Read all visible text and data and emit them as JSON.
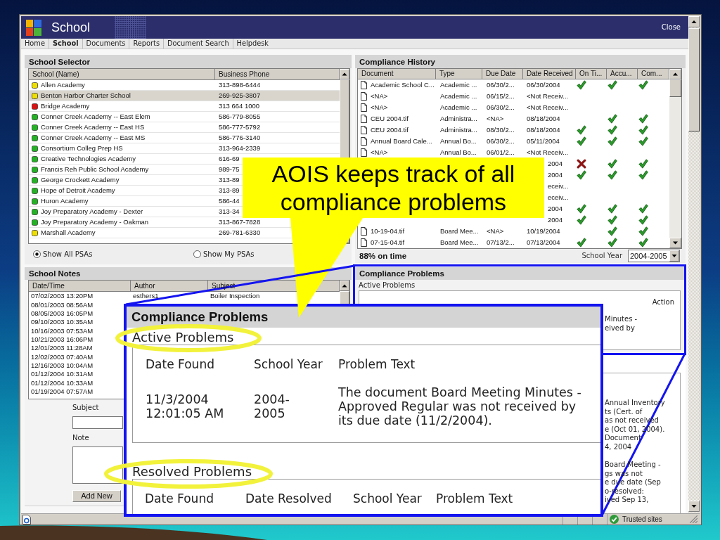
{
  "window": {
    "title": "School",
    "close_label": "Close"
  },
  "menu": [
    {
      "label": "Home",
      "selected": false
    },
    {
      "label": "School",
      "selected": true
    },
    {
      "label": "Documents",
      "selected": false
    },
    {
      "label": "Reports",
      "selected": false
    },
    {
      "label": "Document Search",
      "selected": false
    },
    {
      "label": "Helpdesk",
      "selected": false
    }
  ],
  "school_selector": {
    "title": "School Selector",
    "columns": [
      "School (Name)",
      "Business Phone"
    ],
    "rows": [
      {
        "name": "Allen Academy",
        "phone": "313-898-6444",
        "color": "#efdf00",
        "selected": false
      },
      {
        "name": "Benton Harbor Charter School",
        "phone": "269-925-3807",
        "color": "#efdf00",
        "selected": true
      },
      {
        "name": "Bridge Academy",
        "phone": "313 664 1000",
        "color": "#dd1111",
        "selected": false
      },
      {
        "name": "Conner Creek Academy -- East Elem",
        "phone": "586-779-8055",
        "color": "#22b322",
        "selected": false
      },
      {
        "name": "Conner Creek Academy -- East HS",
        "phone": "586-777-5792",
        "color": "#22b322",
        "selected": false
      },
      {
        "name": "Conner Creek Academy -- East MS",
        "phone": "586-776-3140",
        "color": "#22b322",
        "selected": false
      },
      {
        "name": "Consortium Colleg Prep HS",
        "phone": "313-964-2339",
        "color": "#22b322",
        "selected": false
      },
      {
        "name": "Creative Technologies Academy",
        "phone": "616-69",
        "color": "#22b322",
        "selected": false
      },
      {
        "name": "Francis Reh Public School Academy",
        "phone": "989-75",
        "color": "#22b322",
        "selected": false
      },
      {
        "name": "George Crockett Academy",
        "phone": "313-89",
        "color": "#22b322",
        "selected": false
      },
      {
        "name": "Hope of Detroit Academy",
        "phone": "313-89",
        "color": "#22b322",
        "selected": false
      },
      {
        "name": "Huron Academy",
        "phone": "586-44",
        "color": "#22b322",
        "selected": false
      },
      {
        "name": "Joy Preparatory Academy - Dexter",
        "phone": "313-34",
        "color": "#22b322",
        "selected": false
      },
      {
        "name": "Joy Preparatory Academy - Oakman",
        "phone": "313-867-7828",
        "color": "#22b322",
        "selected": false
      },
      {
        "name": "Marshall Academy",
        "phone": "269-781-6330",
        "color": "#efdf00",
        "selected": false
      }
    ],
    "filters": [
      {
        "label": "Show All PSAs",
        "selected": true
      },
      {
        "label": "Show My PSAs",
        "selected": false
      }
    ]
  },
  "school_notes": {
    "title": "School Notes",
    "columns": [
      "Date/Time",
      "Author",
      "Subject"
    ],
    "rows": [
      {
        "date": "07/02/2003 13:20PM",
        "author": "esthers1",
        "subject": "Boiler Inspection"
      },
      {
        "date": "08/01/2003 08:56AM"
      },
      {
        "date": "08/05/2003 16:05PM"
      },
      {
        "date": "09/10/2003 10:35AM"
      },
      {
        "date": "10/16/2003 07:53AM"
      },
      {
        "date": "10/21/2003 16:06PM"
      },
      {
        "date": "12/01/2003 11:28AM"
      },
      {
        "date": "12/02/2003 07:40AM"
      },
      {
        "date": "12/16/2003 10:04AM"
      },
      {
        "date": "01/12/2004 10:31AM"
      },
      {
        "date": "01/12/2004 10:33AM"
      },
      {
        "date": "01/19/2004 07:57AM"
      }
    ],
    "subject_label": "Subject",
    "note_label": "Note",
    "add_button": "Add New"
  },
  "compliance_history": {
    "title": "Compliance History",
    "columns": [
      "Document",
      "Type",
      "Due Date",
      "Date Received",
      "On Ti...",
      "Accu...",
      "Com..."
    ],
    "rows": [
      {
        "kind": "full",
        "document": "Academic School C...",
        "type": "Academic ...",
        "due_date": "06/30/2...",
        "date_received": "06/30/2004",
        "on_time": true,
        "accurate": true,
        "complete": true
      },
      {
        "kind": "full",
        "document": "<NA>",
        "type": "Academic ...",
        "due_date": "06/15/2...",
        "date_received": "<Not Receiv..."
      },
      {
        "kind": "full",
        "document": "<NA>",
        "type": "Academic ...",
        "due_date": "06/30/2...",
        "date_received": "<Not Receiv..."
      },
      {
        "kind": "full",
        "document": "CEU 2004.tif",
        "type": "Administra...",
        "due_date": "<NA>",
        "date_received": "08/18/2004",
        "accurate": true,
        "complete": true
      },
      {
        "kind": "full",
        "document": "CEU 2004.tif",
        "type": "Administra...",
        "due_date": "08/30/2...",
        "date_received": "08/18/2004",
        "on_time": true,
        "accurate": true,
        "complete": true
      },
      {
        "kind": "full",
        "document": "Annual Board Cale...",
        "type": "Annual Bo...",
        "due_date": "06/30/2...",
        "date_received": "05/11/2004",
        "on_time": true,
        "accurate": true,
        "complete": true
      },
      {
        "kind": "full",
        "document": "<NA>",
        "type": "Annual Bo...",
        "due_date": "06/01/2...",
        "date_received": "<Not Receiv..."
      },
      {
        "kind": "covered",
        "date_received": "2004",
        "on_time": false,
        "accurate": true,
        "complete": true
      },
      {
        "kind": "covered",
        "date_received": "2004",
        "on_time": true,
        "accurate": true,
        "complete": true
      },
      {
        "kind": "covered",
        "date_received": "eceiv..."
      },
      {
        "kind": "covered",
        "date_received": "eceiv..."
      },
      {
        "kind": "covered",
        "date_received": "2004",
        "on_time": true,
        "accurate": true,
        "complete": true
      },
      {
        "kind": "covered",
        "date_received": "2004",
        "on_time": true,
        "accurate": true,
        "complete": true
      },
      {
        "kind": "full",
        "document": "10-19-04.tif",
        "type": "Board Mee...",
        "due_date": "<NA>",
        "date_received": "10/19/2004",
        "accurate": true,
        "complete": true
      },
      {
        "kind": "full",
        "document": "07-15-04.tif",
        "type": "Board Mee...",
        "due_date": "07/13/2...",
        "date_received": "07/13/2004",
        "on_time": true,
        "accurate": true,
        "complete": true
      }
    ],
    "summary": "88% on time",
    "year_label": "School Year",
    "year_value": "2004-2005"
  },
  "compliance_problems": {
    "title": "Compliance Problems",
    "active_label": "Active Problems",
    "action_label": "Action",
    "active_text": [
      "Minutes -",
      "eived by"
    ],
    "resolved_text": [
      [
        "Annual Inventory",
        "ts (Cert. of",
        "as not received",
        "e (Oct 01, 2004).",
        "Document",
        "4, 2004"
      ],
      [
        "Board Meeting -",
        "gs was not",
        "e due date (Sep",
        "o-resolved:",
        "ived Sep 13,"
      ]
    ]
  },
  "zoom_inset": {
    "title": "Compliance Problems",
    "active_label": "Active Problems",
    "active_columns": [
      "Date Found",
      "School Year",
      "Problem Text"
    ],
    "active_rows": [
      {
        "date_found": "11/3/2004 12:01:05 AM",
        "school_year": "2004-2005",
        "problem_text": "The document Board Meeting Minutes - Approved Regular was not received by its due date (11/2/2004)."
      }
    ],
    "resolved_label": "Resolved Problems",
    "resolved_columns": [
      "Date Found",
      "Date Resolved",
      "School Year",
      "Problem Text"
    ]
  },
  "callout": {
    "text": "AOIS keeps track of all compliance problems"
  },
  "status_bar": {
    "zone": "Trusted sites"
  }
}
